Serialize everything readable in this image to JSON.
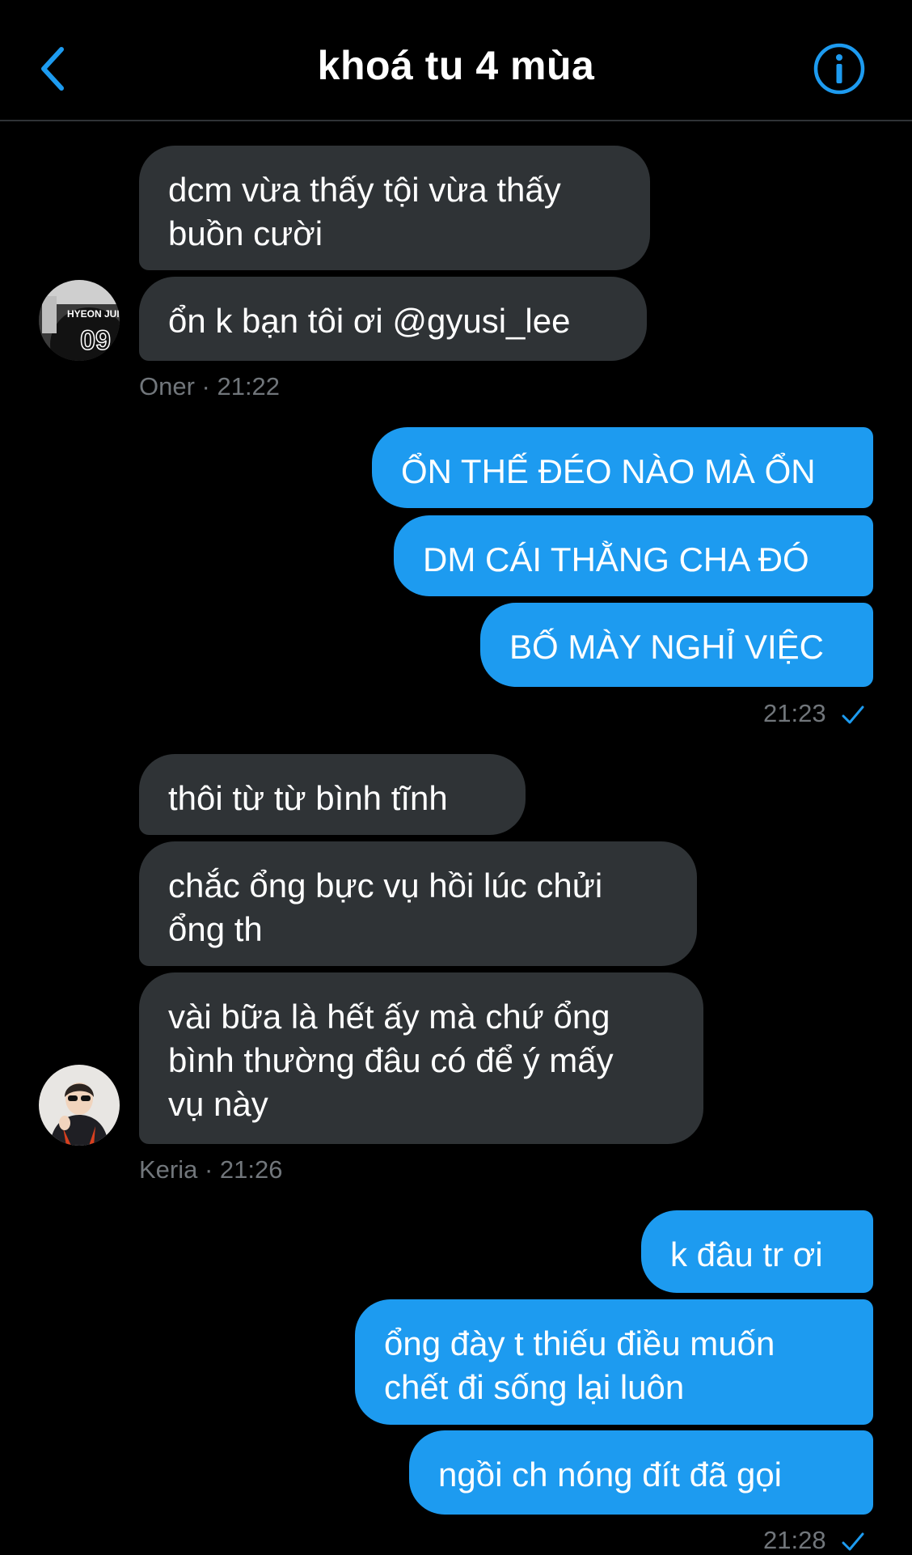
{
  "header": {
    "title": "khoá tu 4 mùa",
    "back_icon": "chevron-left-icon",
    "info_icon": "info-icon",
    "accent_color": "#1d9bf0"
  },
  "messages": {
    "m1": {
      "lines": [
        "dcm vừa thấy tội vừa thấy",
        "buồn cười"
      ]
    },
    "m2": {
      "lines": [
        "ổn k bạn tôi ơi @gyusi_lee"
      ]
    },
    "oner_meta": "Oner · 21:22",
    "m3": {
      "lines": [
        "ỔN THẾ ĐÉO NÀO MÀ ỔN"
      ]
    },
    "m4": {
      "lines": [
        "DM CÁI THẰNG CHA ĐÓ"
      ]
    },
    "m5": {
      "lines": [
        "BỐ MÀY NGHỈ VIỆC"
      ]
    },
    "sent_meta_1": "21:23",
    "m6": {
      "lines": [
        "thôi từ từ bình tĩnh"
      ]
    },
    "m7": {
      "lines": [
        "chắc ổng bực vụ hồi lúc chửi",
        "ổng th"
      ]
    },
    "m8": {
      "lines": [
        "vài bữa là hết ấy mà chứ ổng",
        "bình thường đâu có để ý mấy",
        "vụ này"
      ]
    },
    "keria_meta": "Keria · 21:26",
    "m9": {
      "lines": [
        "k đâu tr ơi"
      ]
    },
    "m10": {
      "lines": [
        "ổng đày t thiếu điều muốn",
        "chết đi sống lại luôn"
      ]
    },
    "m11": {
      "lines": [
        "ngồi ch nóng đít đã gọi"
      ]
    },
    "sent_meta_2": "21:28"
  },
  "avatars": {
    "oner_text": "HYEON JUN",
    "oner_number": "09"
  },
  "colors": {
    "incoming_bubble": "#2f3336",
    "outgoing_bubble": "#1d9bf0",
    "meta_text": "#71767b"
  }
}
